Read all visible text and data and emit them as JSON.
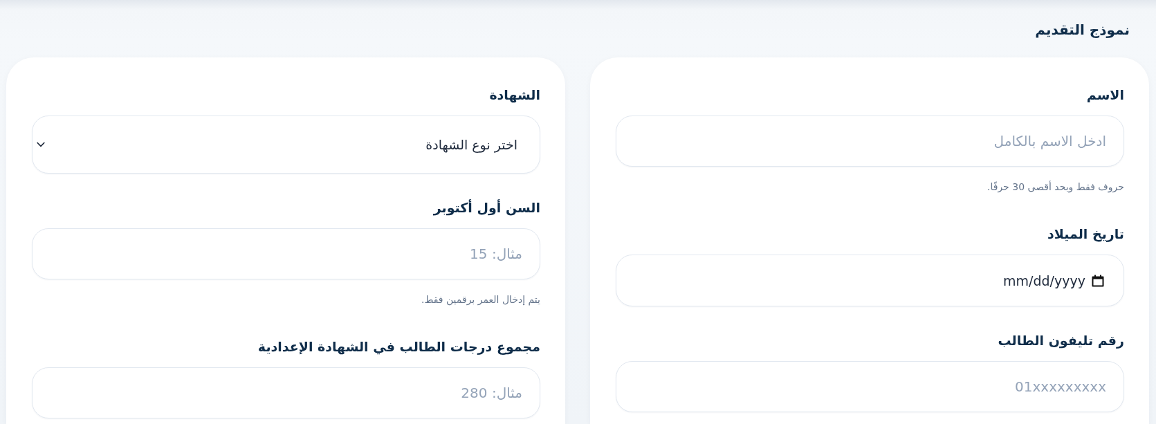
{
  "page_title": "نموذج التقديم",
  "cards": [
    {
      "fields": [
        {
          "kind": "text",
          "label": "الاسم",
          "placeholder": "ادخل الاسم بالكامل",
          "hint": "حروف فقط وبحد أقصى 30 حرفًا."
        },
        {
          "kind": "date",
          "label": "تاريخ الميلاد",
          "placeholder": "mm/dd/yyyy"
        },
        {
          "kind": "text",
          "label": "رقم تليفون الطالب",
          "placeholder": "01xxxxxxxxx"
        }
      ]
    },
    {
      "fields": [
        {
          "kind": "select",
          "label": "الشهادة",
          "value": "اختر نوع الشهادة"
        },
        {
          "kind": "text",
          "label": "السن أول أكتوبر",
          "placeholder": "مثال: 15",
          "hint": "يتم إدخال العمر برقمين فقط."
        },
        {
          "kind": "text",
          "label": "مجموع درجات الطالب في الشهادة الإعدادية",
          "placeholder": "مثال: 280"
        }
      ]
    }
  ]
}
